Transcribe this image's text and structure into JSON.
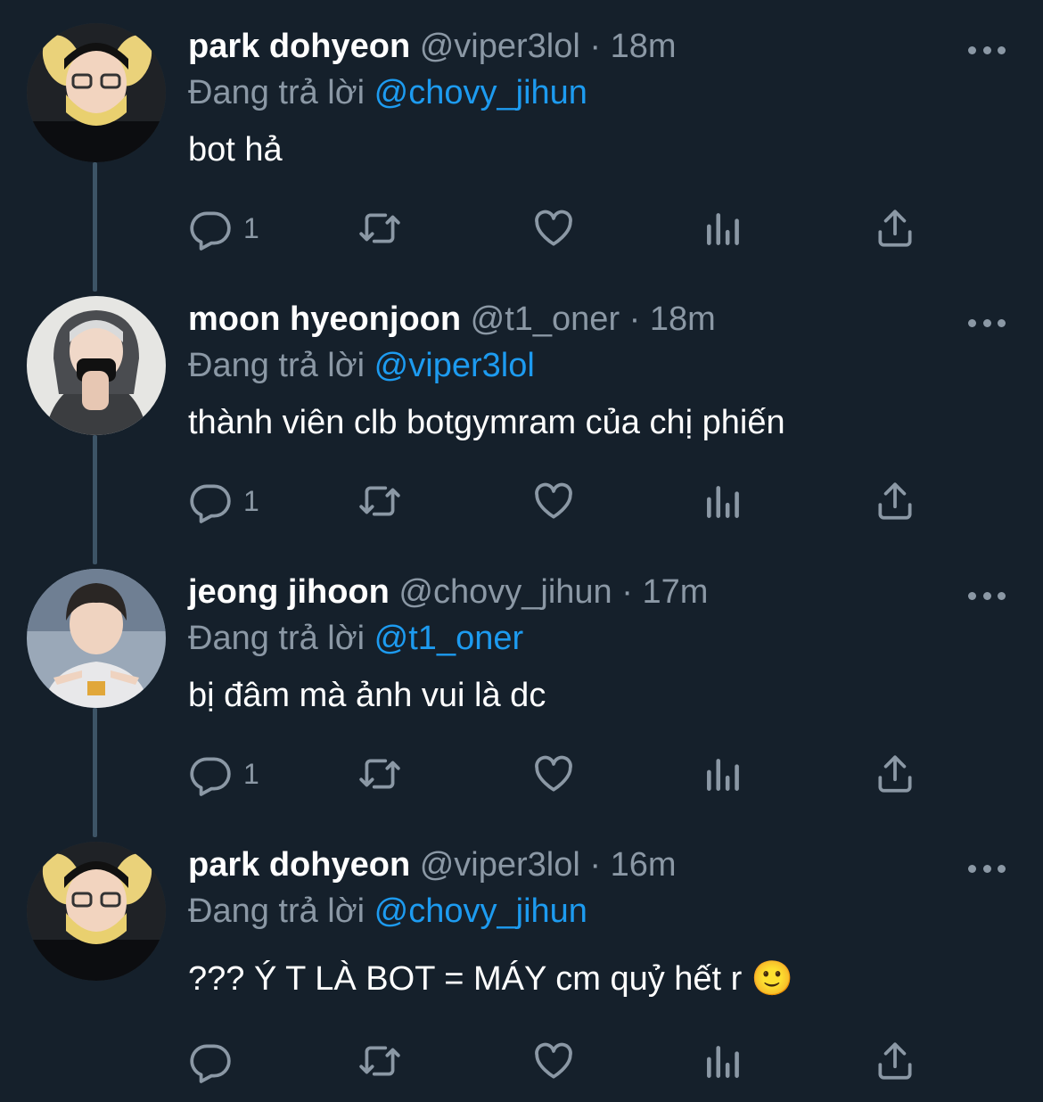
{
  "tweets": [
    {
      "name": "park dohyeon",
      "handle": "@viper3lol",
      "time": "18m",
      "reply_prefix": "Đang trả lời",
      "reply_to": "@chovy_jihun",
      "text": "bot hả",
      "reply_count": "1"
    },
    {
      "name": "moon hyeonjoon",
      "handle": "@t1_oner",
      "time": "18m",
      "reply_prefix": "Đang trả lời",
      "reply_to": "@viper3lol",
      "text": "thành viên clb botgymram của chị phiến",
      "reply_count": "1"
    },
    {
      "name": "jeong jihoon",
      "handle": "@chovy_jihun",
      "time": "17m",
      "reply_prefix": "Đang trả lời",
      "reply_to": "@t1_oner",
      "text": "bị đâm mà ảnh vui là dc",
      "reply_count": "1"
    },
    {
      "name": "park dohyeon",
      "handle": "@viper3lol",
      "time": "16m",
      "reply_prefix": "Đang trả lời",
      "reply_to": "@chovy_jihun",
      "text": "??? Ý T LÀ BOT = MÁY cm quỷ hết r 🙂",
      "reply_count": ""
    }
  ],
  "separator": "·",
  "colors": {
    "background": "#15202b",
    "text_primary": "#ffffff",
    "text_secondary": "#8b98a5",
    "link": "#1d9bf0",
    "thread_line": "#3d5466"
  },
  "icons": [
    "reply-icon",
    "retweet-icon",
    "like-icon",
    "views-icon",
    "share-icon",
    "more-options-icon"
  ]
}
